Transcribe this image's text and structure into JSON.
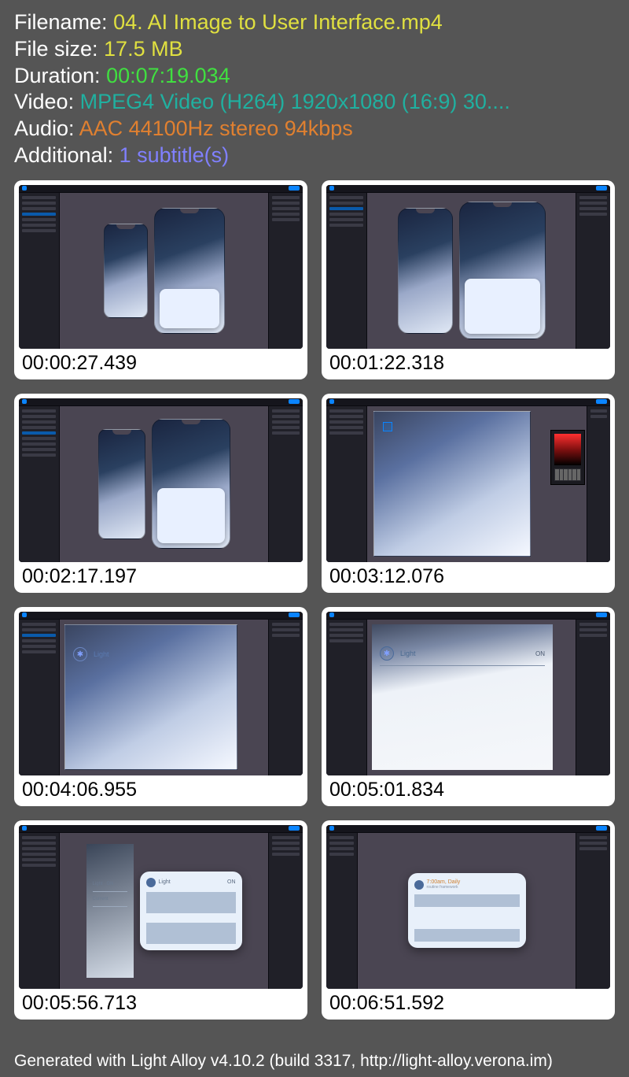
{
  "meta": {
    "filename_label": "Filename: ",
    "filename_value": "04. AI Image to User Interface.mp4",
    "filesize_label": "File size: ",
    "filesize_value": "17.5 MB",
    "duration_label": "Duration: ",
    "duration_value": "00:07:19.034",
    "video_label": "Video: ",
    "video_value": "MPEG4 Video (H264) 1920x1080 (16:9) 30....",
    "audio_label": "Audio: ",
    "audio_value": "AAC 44100Hz stereo 94kbps",
    "additional_label": "Additional: ",
    "additional_value": "1 subtitle(s)"
  },
  "thumbs": [
    {
      "ts": "00:00:27.439"
    },
    {
      "ts": "00:01:22.318"
    },
    {
      "ts": "00:02:17.197"
    },
    {
      "ts": "00:03:12.076"
    },
    {
      "ts": "00:04:06.955"
    },
    {
      "ts": "00:05:01.834"
    },
    {
      "ts": "00:05:56.713"
    },
    {
      "ts": "00:06:51.592"
    }
  ],
  "footer": "Generated with Light Alloy v4.10.2 (build 3317, http://light-alloy.verona.im)"
}
